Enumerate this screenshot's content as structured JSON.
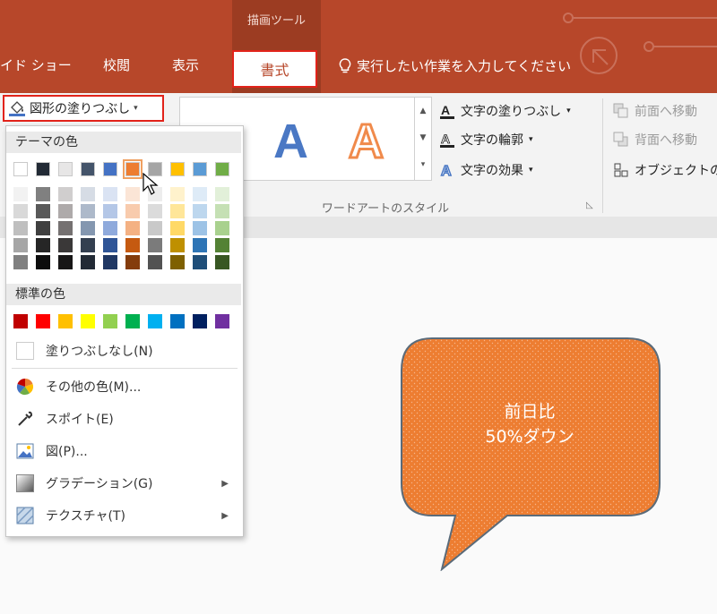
{
  "ribbon": {
    "contextual_tab_group": "描画ツール",
    "tabs": [
      "イド ショー",
      "校閲",
      "表示"
    ],
    "active_tab": "書式",
    "tell_me": "実行したい作業を入力してください"
  },
  "format_group": {
    "shape_fill_label": "図形の塗りつぶし",
    "wordart_styles_label": "ワードアートのスタイル",
    "wordart_glyph": "A",
    "text_fill": "文字の塗りつぶし",
    "text_outline": "文字の輪郭",
    "text_effects": "文字の効果",
    "bring_forward": "前面へ移動",
    "send_backward": "背面へ移動",
    "selection_pane": "オブジェクトの"
  },
  "dropdown": {
    "theme_colors_label": "テーマの色",
    "standard_colors_label": "標準の色",
    "theme_top_row": [
      "#ffffff",
      "#222a35",
      "#e7e6e6",
      "#44546a",
      "#4472c4",
      "#ed7d31",
      "#a5a5a5",
      "#ffc000",
      "#5b9bd5",
      "#70ad47"
    ],
    "theme_shades": [
      [
        "#f2f2f2",
        "#d9d9d9",
        "#bfbfbf",
        "#a6a6a6",
        "#808080"
      ],
      [
        "#808080",
        "#595959",
        "#404040",
        "#262626",
        "#0d0d0d"
      ],
      [
        "#d0cece",
        "#aeaaaa",
        "#757171",
        "#3a3838",
        "#171616"
      ],
      [
        "#d6dce5",
        "#adb9ca",
        "#8497b0",
        "#333f50",
        "#222a35"
      ],
      [
        "#dae3f3",
        "#b4c7e7",
        "#8faadc",
        "#2f5597",
        "#203864"
      ],
      [
        "#fbe5d6",
        "#f8cbad",
        "#f4b183",
        "#c55a11",
        "#843c0c"
      ],
      [
        "#ededed",
        "#dbdbdb",
        "#c9c9c9",
        "#7b7b7b",
        "#525252"
      ],
      [
        "#fff2cc",
        "#ffe699",
        "#ffd966",
        "#bf9000",
        "#7f6000"
      ],
      [
        "#deebf7",
        "#bdd7ee",
        "#9dc3e6",
        "#2e75b6",
        "#1f4e79"
      ],
      [
        "#e2f0d9",
        "#c5e0b4",
        "#a9d18e",
        "#548235",
        "#385723"
      ]
    ],
    "standard_colors": [
      "#c00000",
      "#ff0000",
      "#ffc000",
      "#ffff00",
      "#92d050",
      "#00b050",
      "#00b0f0",
      "#0070c0",
      "#002060",
      "#7030a0"
    ],
    "no_fill": "塗りつぶしなし(N)",
    "more_colors": "その他の色(M)...",
    "eyedropper": "スポイト(E)",
    "picture": "図(P)...",
    "gradient": "グラデーション(G)",
    "texture": "テクスチャ(T)"
  },
  "shape": {
    "line1": "前日比",
    "line2": "50%ダウン",
    "fill_color": "#ed7d31"
  },
  "colors": {
    "ribbon": "#b7472a",
    "highlight": "#e2231a"
  }
}
